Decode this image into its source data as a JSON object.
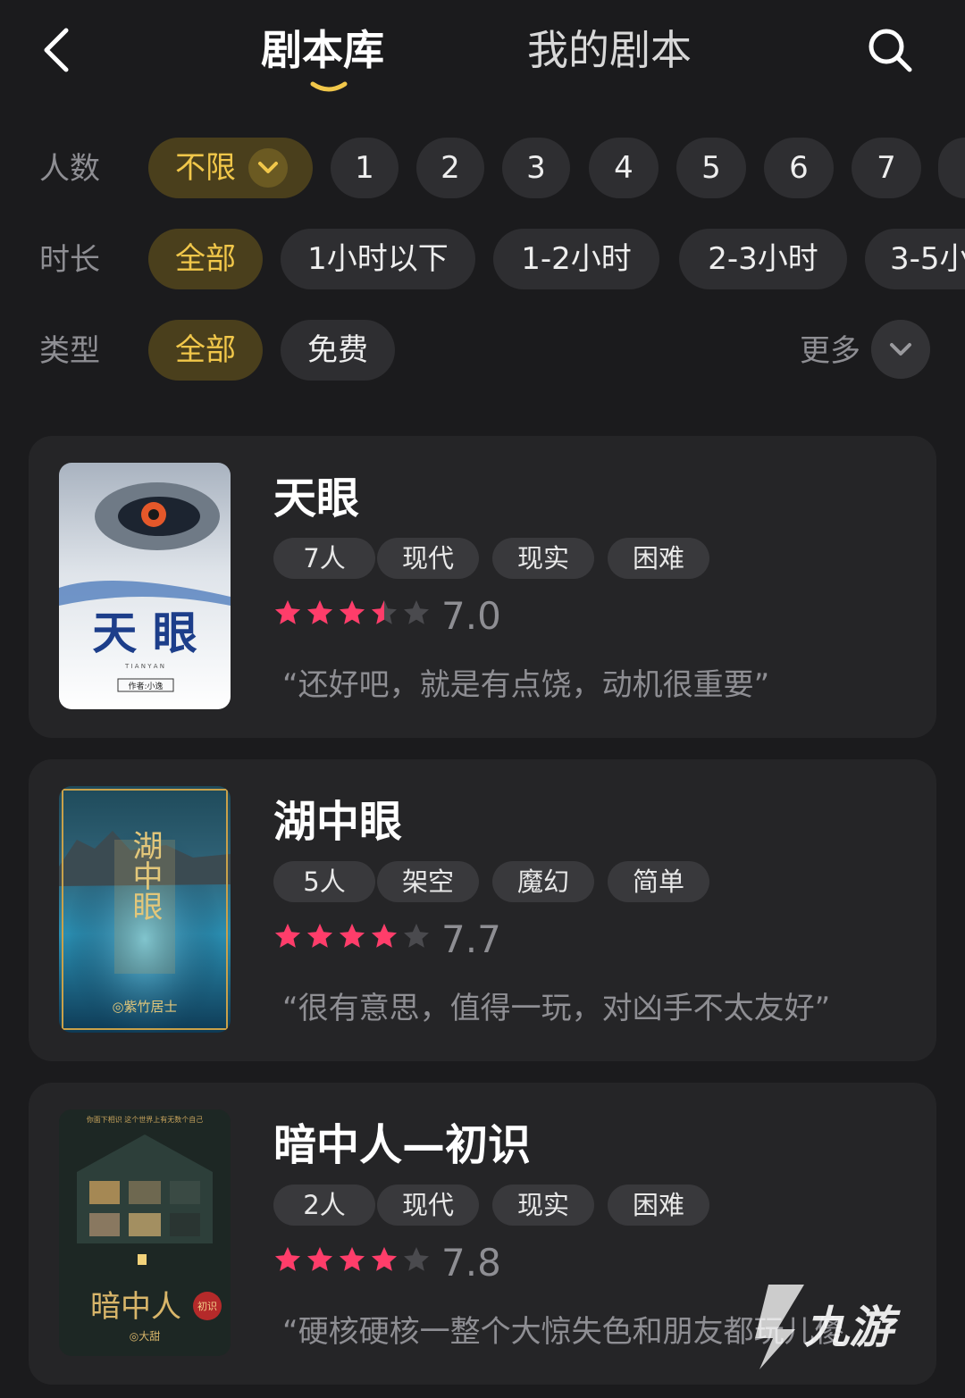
{
  "header": {
    "tabs": [
      {
        "label": "剧本库",
        "active": true
      },
      {
        "label": "我的剧本",
        "active": false
      }
    ],
    "accent_color": "#f1c74a"
  },
  "filters": {
    "players": {
      "label": "人数",
      "options": [
        "不限",
        "1",
        "2",
        "3",
        "4",
        "5",
        "6",
        "7"
      ],
      "selected": "不限"
    },
    "duration": {
      "label": "时长",
      "options": [
        "全部",
        "1小时以下",
        "1-2小时",
        "2-3小时",
        "3-5小"
      ],
      "selected": "全部"
    },
    "category": {
      "label": "类型",
      "options": [
        "全部",
        "免费"
      ],
      "selected": "全部",
      "more_label": "更多"
    }
  },
  "scripts": [
    {
      "title": "天眼",
      "tags": [
        "7人",
        "现代",
        "现实",
        "困难"
      ],
      "stars": 3.5,
      "rating": "7.0",
      "quote": "“还好吧，就是有点饶，动机很重要”",
      "cover": {
        "title": "天 眼",
        "subtitle": "T I A N    Y A N",
        "author": "作者:小逸"
      }
    },
    {
      "title": "湖中眼",
      "tags": [
        "5人",
        "架空",
        "魔幻",
        "简单"
      ],
      "stars": 4,
      "rating": "7.7",
      "quote": "“很有意思，值得一玩，对凶手不太友好”",
      "cover": {
        "title": "湖中眼",
        "author": "◎紫竹居士"
      }
    },
    {
      "title": "暗中人—初识",
      "tags": [
        "2人",
        "现代",
        "现实",
        "困难"
      ],
      "stars": 4,
      "rating": "7.8",
      "quote": "“硬核硬核一整个大惊失色和朋友都玩儿傻",
      "cover": {
        "title": "暗中人",
        "badge": "初识",
        "author": "◎大甜",
        "topline": "你面下相识 这个世界上有无数个自己"
      }
    }
  ],
  "star_color": "#ff3d6a",
  "watermark": "九游"
}
